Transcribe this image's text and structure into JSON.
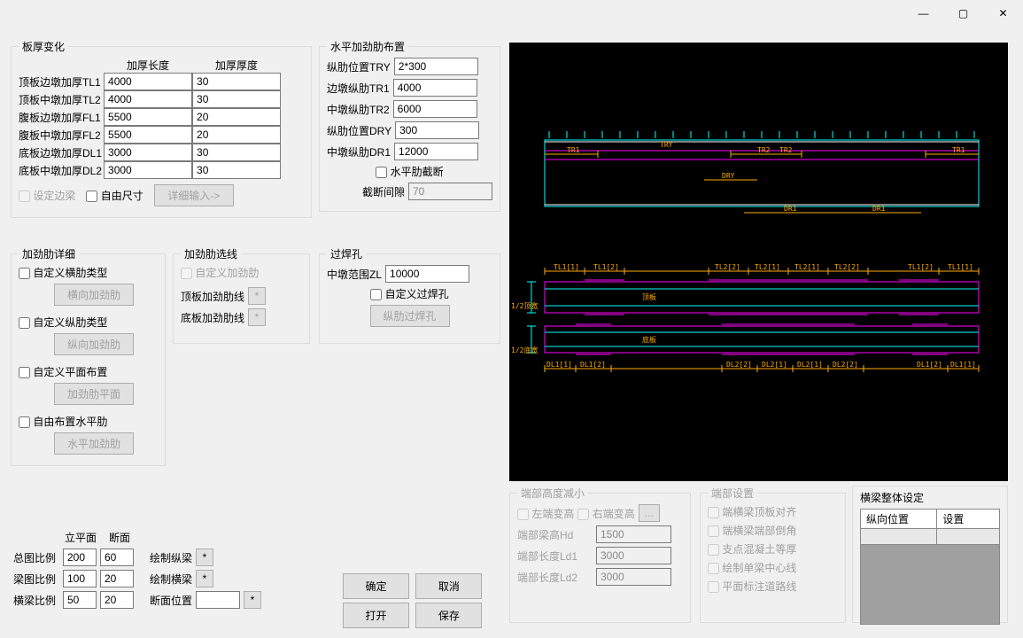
{
  "titlebar": {
    "min": "—",
    "max": "▢",
    "close": "✕"
  },
  "panels": {
    "thickness": {
      "legend": "板厚变化",
      "col_len": "加厚长度",
      "col_thk": "加厚厚度",
      "rows": [
        {
          "label": "顶板边墩加厚TL1",
          "len": "4000",
          "thk": "30"
        },
        {
          "label": "顶板中墩加厚TL2",
          "len": "4000",
          "thk": "30"
        },
        {
          "label": "腹板边墩加厚FL1",
          "len": "5500",
          "thk": "20"
        },
        {
          "label": "腹板中墩加厚FL2",
          "len": "5500",
          "thk": "20"
        },
        {
          "label": "底板边墩加厚DL1",
          "len": "3000",
          "thk": "30"
        },
        {
          "label": "底板中墩加厚DL2",
          "len": "3000",
          "thk": "30"
        }
      ],
      "chk_edge": "设定边梁",
      "chk_free": "自由尺寸",
      "btn_detail": "详细输入->"
    },
    "hstiff": {
      "legend": "水平加劲肋布置",
      "rows": [
        {
          "label": "纵肋位置TRY",
          "val": "2*300"
        },
        {
          "label": "边墩纵肋TR1",
          "val": "4000"
        },
        {
          "label": "中墩纵肋TR2",
          "val": "6000"
        },
        {
          "label": "纵肋位置DRY",
          "val": "300"
        },
        {
          "label": "中墩纵肋DR1",
          "val": "12000"
        }
      ],
      "chk_cut": "水平肋截断",
      "gap_label": "截断间隙",
      "gap_val": "70"
    },
    "stiff_detail": {
      "legend": "加劲肋详细",
      "items": [
        {
          "chk": "自定义横肋类型",
          "btn": "横向加劲肋"
        },
        {
          "chk": "自定义纵肋类型",
          "btn": "纵向加劲肋"
        },
        {
          "chk": "自定义平面布置",
          "btn": "加劲肋平面"
        },
        {
          "chk": "自由布置水平肋",
          "btn": "水平加劲肋"
        }
      ]
    },
    "stiff_line": {
      "legend": "加劲肋选线",
      "chk_custom": "自定义加劲肋",
      "top_line": "顶板加劲肋线",
      "bot_line": "底板加劲肋线",
      "star": "*"
    },
    "weld": {
      "legend": "过焊孔",
      "range_label": "中墩范围ZL",
      "range_val": "10000",
      "chk_custom": "自定义过焊孔",
      "btn": "纵肋过焊孔"
    },
    "end_h": {
      "legend": "端部高度减小",
      "chk_left": "左端变高",
      "chk_right": "右端变高",
      "dots": "...",
      "h_label": "端部梁高Hd",
      "h_val": "1500",
      "l1_label": "端部长度Ld1",
      "l1_val": "3000",
      "l2_label": "端部长度Ld2",
      "l2_val": "3000"
    },
    "end_s": {
      "legend": "端部设置",
      "items": [
        "端横梁顶板对齐",
        "端横梁端部倒角",
        "支点混凝土等厚",
        "绘制单梁中心线",
        "平面标注道路线"
      ]
    },
    "beam_s": {
      "legend": "横梁整体设定",
      "col1": "纵向位置",
      "col2": "设置"
    }
  },
  "ratios": {
    "col_plan": "立平面",
    "col_sec": "断面",
    "total_label": "总图比例",
    "total_plan": "200",
    "total_sec": "60",
    "beam_label": "梁图比例",
    "beam_plan": "100",
    "beam_sec": "20",
    "cross_label": "横梁比例",
    "cross_plan": "50",
    "cross_sec": "20",
    "draw_long": "绘制纵梁",
    "draw_cross": "绘制横梁",
    "sec_pos": "断面位置",
    "star": "*"
  },
  "buttons": {
    "ok": "确定",
    "cancel": "取消",
    "open": "打开",
    "save": "保存"
  },
  "cad": {
    "labels": {
      "TR1": "TR1",
      "TR2": "TR2",
      "TRY": "TRY",
      "DRY": "DRY",
      "DR1": "DR1",
      "half_top": "1/2顶宽",
      "half_bot": "1/2底宽",
      "top_plate": "顶板",
      "bot_plate": "底板",
      "TL11": "TL1[1]",
      "TL12": "TL1[2]",
      "TL21": "TL2[1]",
      "TL22": "TL2[2]",
      "DL11": "DL1[1]",
      "DL12": "DL1[2]",
      "DL21": "DL2[1]",
      "DL22": "DL2[2]"
    }
  }
}
